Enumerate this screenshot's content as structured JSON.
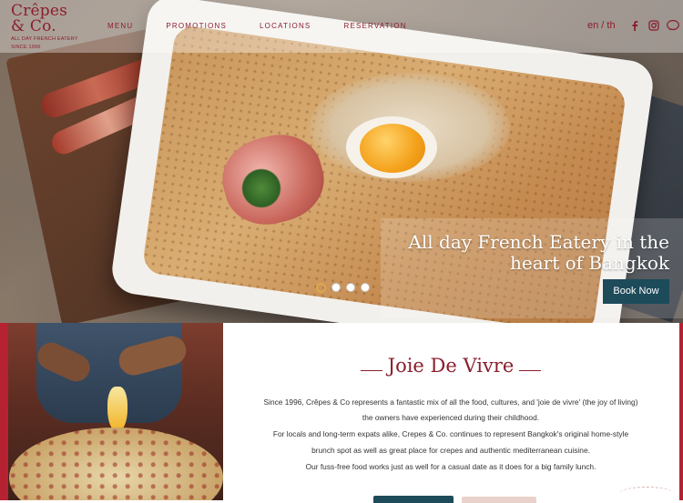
{
  "brand": {
    "name": "Crêpes & Co.",
    "tagline": "ALL DAY FRENCH EATERY",
    "since": "SINCE 1996",
    "color": "#8b1e2d"
  },
  "nav": {
    "items": [
      {
        "label": "MENU"
      },
      {
        "label": "PROMOTIONS"
      },
      {
        "label": "LOCATIONS"
      },
      {
        "label": "RESERVATION"
      }
    ]
  },
  "language": {
    "label": "en / th"
  },
  "social": {
    "icons": [
      "facebook-icon",
      "instagram-icon",
      "line-icon"
    ]
  },
  "hero": {
    "title": "All day French Eatery in the heart of Bangkok",
    "book_button": "Book Now",
    "slides_count": 4,
    "active_slide": 1,
    "button_color": "#1d4b5a"
  },
  "about": {
    "title": "Joie De Vivre",
    "paragraphs": [
      "Since 1996, Crêpes & Co represents a fantastic mix of all the food, cultures, and 'joie de vivre' (the joy of living)",
      "the owners have experienced during their childhood.",
      "For locals and long-term expats alike, Crepes & Co. continues to represent Bangkok's original home-style",
      "brunch spot as well as great place for crepes and authentic mediterranean cuisine.",
      "Our fuss-free food works just as well for a casual date as it does for a big family lunch."
    ]
  }
}
